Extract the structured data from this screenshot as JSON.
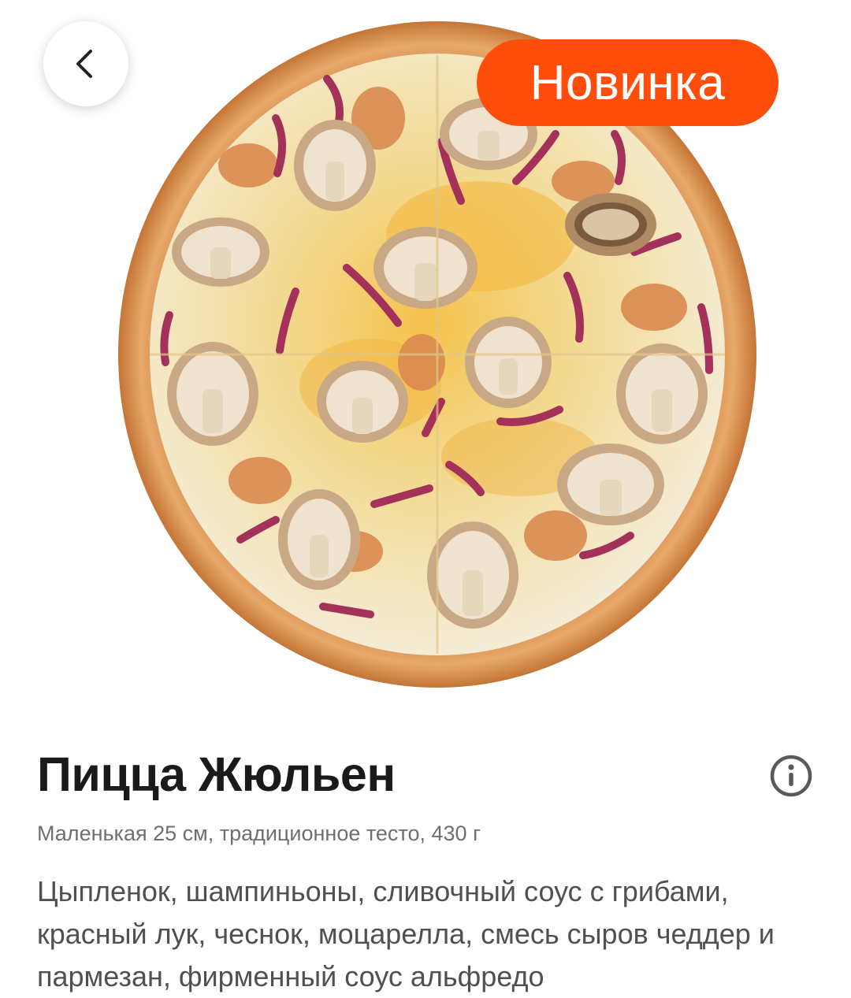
{
  "nav": {
    "back_icon": "chevron-left-icon"
  },
  "product": {
    "badge": "Новинка",
    "name": "Пицца Жюльен",
    "details": "Маленькая 25 см, традиционное тесто, 430 г",
    "ingredients": "Цыпленок, шампиньоны, сливочный соус с грибами, красный лук, чеснок, моцарелла, смесь сыров чеддер и пармезан, фирменный соус альфредо",
    "info_icon": "info-icon",
    "image_icon": "pizza-image"
  },
  "colors": {
    "badge": "#ff4d0c",
    "title": "#1a1a1a",
    "subtitle": "#6f6f6f",
    "body_text": "#505050"
  }
}
